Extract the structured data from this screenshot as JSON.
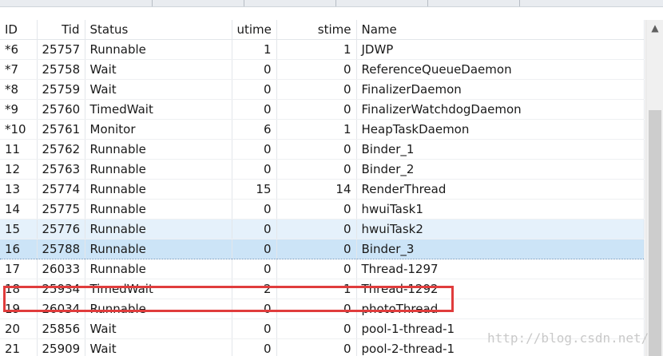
{
  "table": {
    "columns": [
      "ID",
      "Tid",
      "Status",
      "utime",
      "stime",
      "Name"
    ],
    "rows": [
      {
        "id": "*6",
        "tid": "25757",
        "status": "Runnable",
        "utime": "1",
        "stime": "1",
        "name": "JDWP"
      },
      {
        "id": "*7",
        "tid": "25758",
        "status": "Wait",
        "utime": "0",
        "stime": "0",
        "name": "ReferenceQueueDaemon"
      },
      {
        "id": "*8",
        "tid": "25759",
        "status": "Wait",
        "utime": "0",
        "stime": "0",
        "name": "FinalizerDaemon"
      },
      {
        "id": "*9",
        "tid": "25760",
        "status": "TimedWait",
        "utime": "0",
        "stime": "0",
        "name": "FinalizerWatchdogDaemon"
      },
      {
        "id": "*10",
        "tid": "25761",
        "status": "Monitor",
        "utime": "6",
        "stime": "1",
        "name": "HeapTaskDaemon"
      },
      {
        "id": "11",
        "tid": "25762",
        "status": "Runnable",
        "utime": "0",
        "stime": "0",
        "name": "Binder_1"
      },
      {
        "id": "12",
        "tid": "25763",
        "status": "Runnable",
        "utime": "0",
        "stime": "0",
        "name": "Binder_2"
      },
      {
        "id": "13",
        "tid": "25774",
        "status": "Runnable",
        "utime": "15",
        "stime": "14",
        "name": "RenderThread"
      },
      {
        "id": "14",
        "tid": "25775",
        "status": "Runnable",
        "utime": "0",
        "stime": "0",
        "name": "hwuiTask1"
      },
      {
        "id": "15",
        "tid": "25776",
        "status": "Runnable",
        "utime": "0",
        "stime": "0",
        "name": "hwuiTask2"
      },
      {
        "id": "16",
        "tid": "25788",
        "status": "Runnable",
        "utime": "0",
        "stime": "0",
        "name": "Binder_3"
      },
      {
        "id": "17",
        "tid": "26033",
        "status": "Runnable",
        "utime": "0",
        "stime": "0",
        "name": "Thread-1297"
      },
      {
        "id": "18",
        "tid": "25934",
        "status": "TimedWait",
        "utime": "2",
        "stime": "1",
        "name": "Thread-1292"
      },
      {
        "id": "19",
        "tid": "26034",
        "status": "Runnable",
        "utime": "0",
        "stime": "0",
        "name": "photoThread"
      },
      {
        "id": "20",
        "tid": "25856",
        "status": "Wait",
        "utime": "0",
        "stime": "0",
        "name": "pool-1-thread-1"
      },
      {
        "id": "21",
        "tid": "25909",
        "status": "Wait",
        "utime": "0",
        "stime": "0",
        "name": "pool-2-thread-1"
      }
    ]
  },
  "hover_row": "15",
  "selected_row": "16",
  "highlighted_row": "19",
  "scrollbar": {
    "up_icon": "▲"
  },
  "watermark": "http://blog.csdn.net/",
  "colors": {
    "highlight": "#e03c3c",
    "selection": "#cce4f7",
    "hover": "#e5f1fb"
  }
}
